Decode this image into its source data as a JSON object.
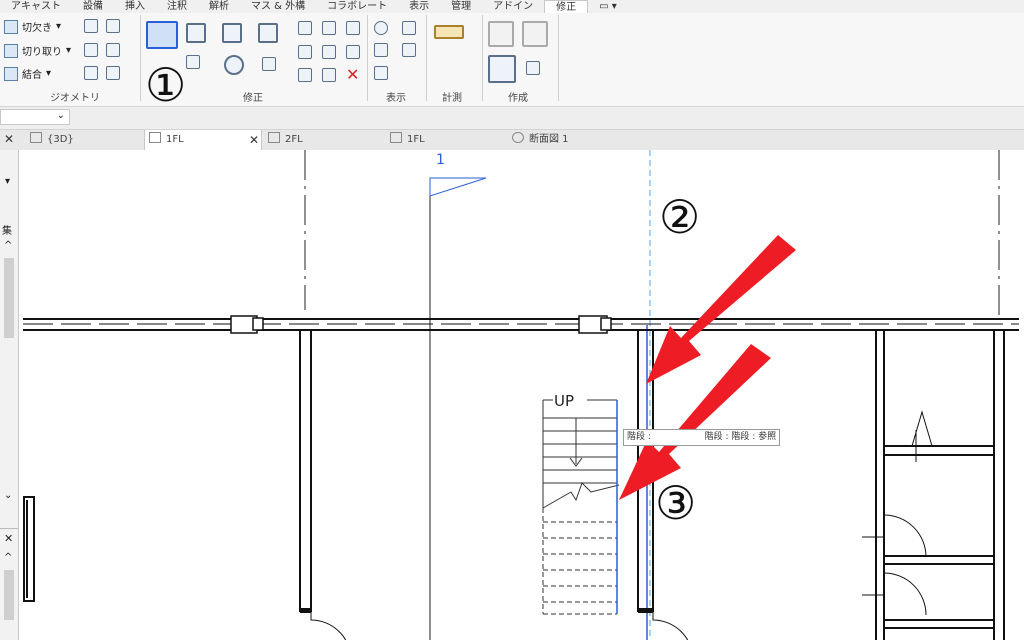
{
  "menubar": {
    "items": [
      "アキャスト",
      "設備",
      "挿入",
      "注釈",
      "解析",
      "マス & 外構",
      "コラボレート",
      "表示",
      "管理",
      "アドイン",
      "修正",
      "▭ ▾"
    ],
    "active_index": 10
  },
  "ribbon": {
    "geometry_panel": {
      "label": "ジオメトリ",
      "cut": "切欠き",
      "uncut": "切り取り",
      "join": "結合"
    },
    "modify_panel": {
      "label": "修正"
    },
    "view_panel": {
      "label": "表示"
    },
    "measure_panel": {
      "label": "計測"
    },
    "create_panel": {
      "label": "作成"
    }
  },
  "view_tabs": [
    {
      "label": "{3D}"
    },
    {
      "label": "1FL",
      "active": true
    },
    {
      "label": "2FL"
    },
    {
      "label": "1FL"
    },
    {
      "label": "断面図 1"
    }
  ],
  "sidebar": {
    "label": "集"
  },
  "canvas": {
    "level_marker": "1",
    "stair_label": "UP",
    "tooltip": "階段 : 階段 : 参照",
    "tooltip_hidden_part": "階段 :"
  },
  "annotations": {
    "callout_1": "①",
    "callout_2": "②",
    "callout_3": "③",
    "arrow_color": "#ee1c24"
  },
  "colors": {
    "selection_blue": "#2b5fd9",
    "wall": "#111111"
  }
}
